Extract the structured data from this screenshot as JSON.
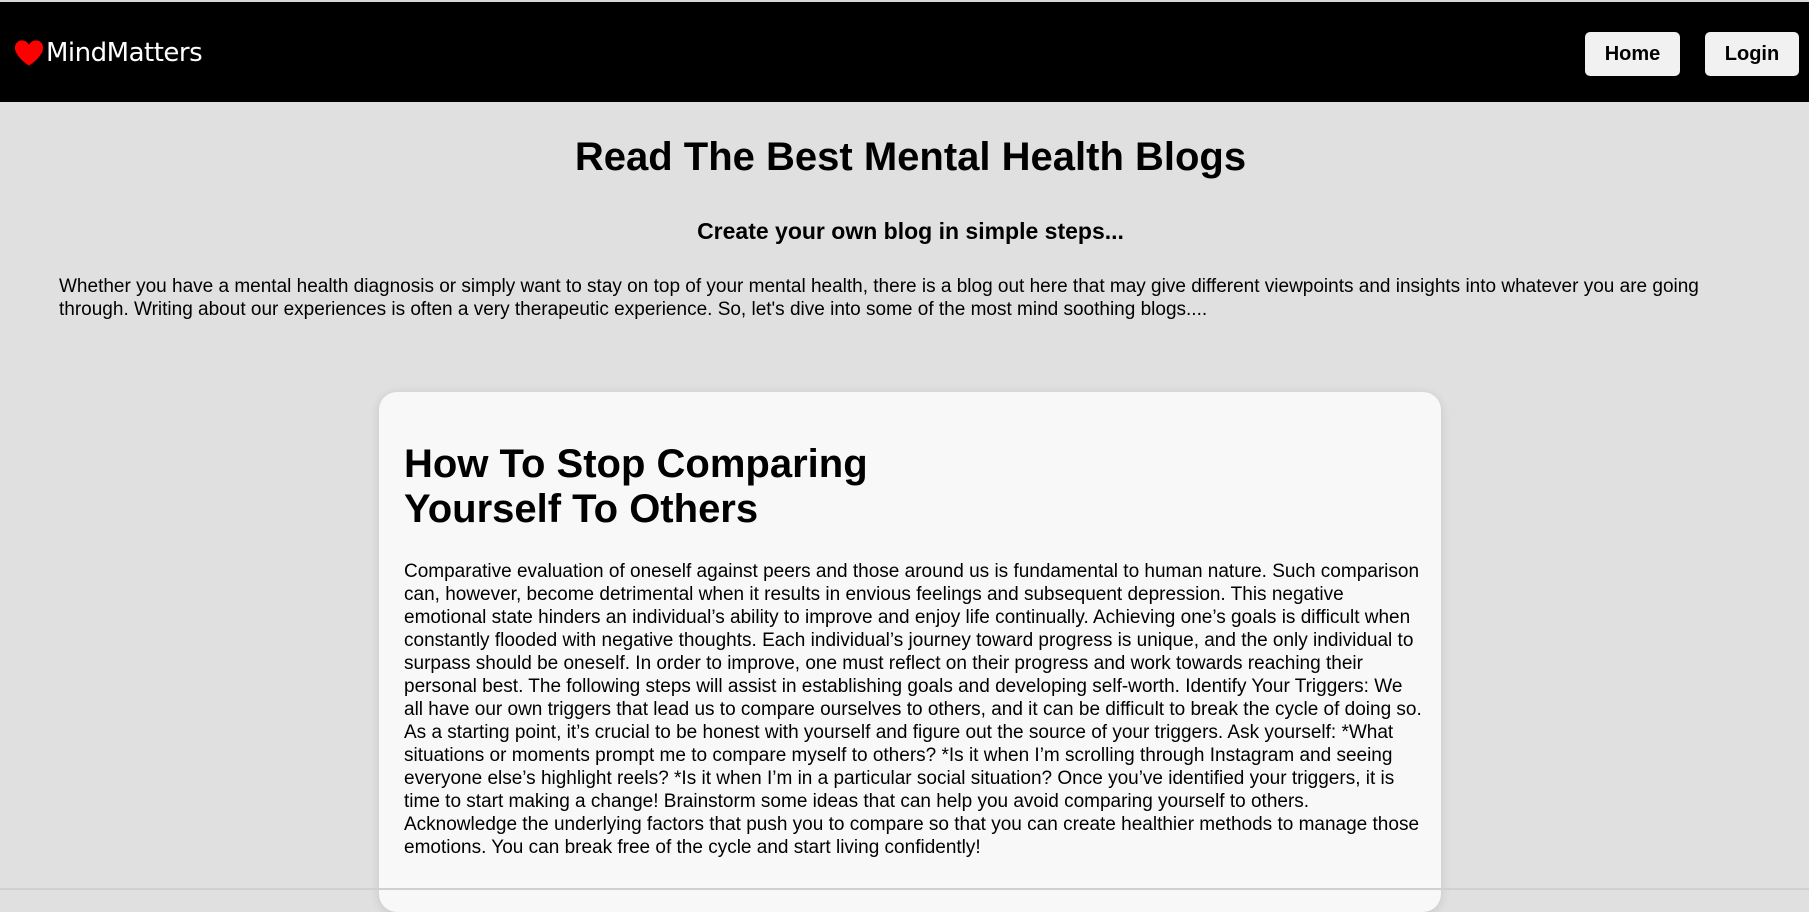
{
  "navbar": {
    "brand": {
      "icon": "heart-icon",
      "name": "MindMatters",
      "icon_color": "#ff0000"
    },
    "buttons": {
      "home": "Home",
      "login": "Login"
    }
  },
  "header": {
    "title": "Read The Best Mental Health Blogs",
    "subtitle": "Create your own blog in simple steps...",
    "intro": "Whether you have a mental health diagnosis or simply want to stay on top of your mental health, there is a blog out here that may give different viewpoints and insights into whatever you are going through. Writing about our experiences is often a very therapeutic experience. So, let's dive into some of the most mind soothing blogs...."
  },
  "blog_post": {
    "title": "How To Stop Comparing Yourself To Others",
    "body": "Comparative evaluation of oneself against peers and those around us is fundamental to human nature. Such comparison can, however, become detrimental when it results in envious feelings and subsequent depression. This negative emotional state hinders an individual’s ability to improve and enjoy life continually. Achieving one’s goals is difficult when constantly flooded with negative thoughts. Each individual’s journey toward progress is unique, and the only individual to surpass should be oneself. In order to improve, one must reflect on their progress and work towards reaching their personal best. The following steps will assist in establishing goals and developing self-worth. Identify Your Triggers: We all have our own triggers that lead us to compare ourselves to others, and it can be difficult to break the cycle of doing so. As a starting point, it’s crucial to be honest with yourself and figure out the source of your triggers. Ask yourself: *What situations or moments prompt me to compare myself to others? *Is it when I’m scrolling through Instagram and seeing everyone else’s highlight reels? *Is it when I’m in a particular social situation? Once you’ve identified your triggers, it is time to start making a change! Brainstorm some ideas that can help you avoid comparing yourself to others. Acknowledge the underlying factors that push you to compare so that you can create healthier methods to manage those emotions. You can break free of the cycle and start living confidently!"
  },
  "colors": {
    "navbar": "#000000",
    "background": "#e0e0e0",
    "card": "#f8f8f8",
    "button": "#f1f1f1"
  }
}
